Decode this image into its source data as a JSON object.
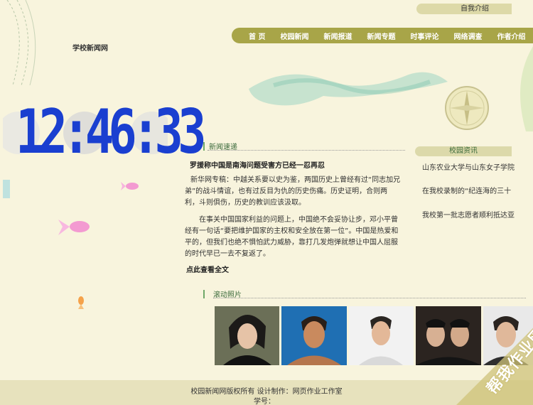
{
  "header": {
    "top_link": "自我介绍",
    "site_name": "学校新闻网",
    "nav": [
      "首 页",
      "校园新闻",
      "新闻报道",
      "新闻专题",
      "时事评论",
      "网络调查",
      "作者介绍"
    ]
  },
  "clock": {
    "time": "12:46:33",
    "digit_color": "#1a3fd0"
  },
  "news": {
    "section_title": "新闻速递",
    "headline": "罗援称中国是南海问题受害方已经一忍再忍",
    "paragraph1": "新华网专稿：中越关系要以史为鉴，两国历史上曾经有过“同志加兄弟”的战斗情谊，也有过反目为仇的历史伤痛。历史证明，合则两利，斗则俱伤，历史的教训应该汲取。",
    "paragraph2": "在事关中国国家利益的问题上，中国绝不会妥协让步，邓小平曾经有一句话“要把维护国家的主权和安全放在第一位”。中国是热爱和平的，但我们也绝不惧怕武力威胁，靠打几发炮弹就想让中国人屈服的时代早已一去不复返了。",
    "read_more": "点此查看全文"
  },
  "sidebar": {
    "title": "校园资讯",
    "items": [
      "山东农业大学与山东女子学院",
      "在我校录制的“纪连海的三十",
      "我校第一批志愿者顺利抵达亚"
    ]
  },
  "photos": {
    "section_title": "滚动照片",
    "items": [
      "photo-1",
      "photo-2",
      "photo-3",
      "photo-4",
      "photo-5"
    ]
  },
  "footer": {
    "line1": "校园新闻网版权所有 设计制作：网页作业工作室",
    "line2": "学号："
  },
  "watermark": "帮我作业网",
  "colors": {
    "nav_bg": "#a8a548",
    "page_bg": "#f8f4dd",
    "footer_bg": "#e7e2bd",
    "accent_green": "#6fa868"
  }
}
